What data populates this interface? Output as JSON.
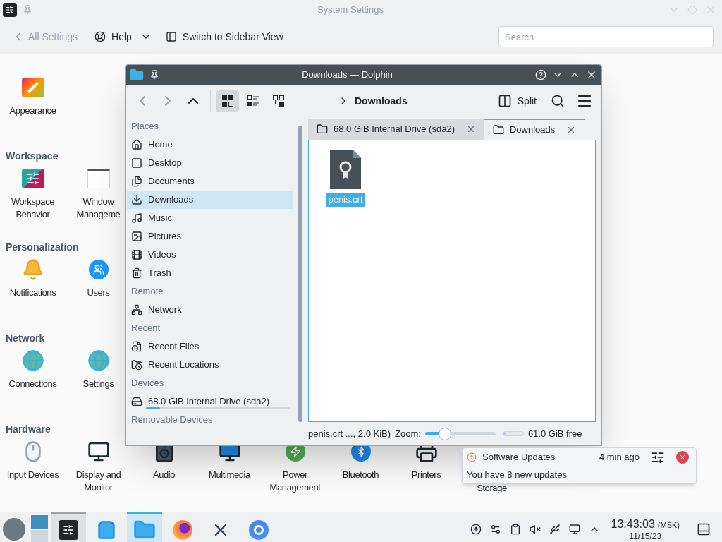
{
  "settings_window": {
    "title": "System Settings",
    "back_button": "All Settings",
    "help_button": "Help",
    "switch_view_button": "Switch to Sidebar View",
    "search": {
      "placeholder": "Search"
    },
    "sections": [
      {
        "items": [
          {
            "label": "Appearance",
            "kind": "appearance"
          }
        ]
      },
      {
        "heading": "Workspace",
        "items": [
          {
            "label": "Workspace Behavior",
            "kind": "workspace"
          },
          {
            "label": "Window Manageme",
            "kind": "window"
          }
        ]
      },
      {
        "heading": "Personalization",
        "items": [
          {
            "label": "Notifications",
            "kind": "bell"
          },
          {
            "label": "Users",
            "kind": "users"
          }
        ]
      },
      {
        "heading": "Network",
        "items": [
          {
            "label": "Connections",
            "kind": "globe"
          },
          {
            "label": "Settings",
            "kind": "globe"
          }
        ]
      },
      {
        "heading": "Hardware",
        "items": [
          {
            "label": "Input Devices",
            "kind": "mouse"
          },
          {
            "label": "Display and Monitor",
            "kind": "display"
          },
          {
            "label": "Audio",
            "kind": "speaker"
          },
          {
            "label": "Multimedia",
            "kind": "media"
          },
          {
            "label": "Power Management",
            "kind": "power"
          },
          {
            "label": "Bluetooth",
            "kind": "bluetooth"
          },
          {
            "label": "Printers",
            "kind": "printer"
          },
          {
            "label": "Storage",
            "kind": "hidden"
          }
        ]
      }
    ]
  },
  "dolphin": {
    "title": "Downloads — Dolphin",
    "view_modes": [
      {
        "kind": "icons",
        "selected": true
      },
      {
        "kind": "details",
        "selected": false
      },
      {
        "kind": "tree",
        "selected": false
      }
    ],
    "breadcrumb": "Downloads",
    "split_button": "Split",
    "places": [
      {
        "heading": "Places",
        "items": [
          {
            "label": "Home",
            "kind": "home",
            "selected": false
          },
          {
            "label": "Desktop",
            "kind": "desktop",
            "selected": false
          },
          {
            "label": "Documents",
            "kind": "documents",
            "selected": false
          },
          {
            "label": "Downloads",
            "kind": "downloads",
            "selected": true
          },
          {
            "label": "Music",
            "kind": "music",
            "selected": false
          },
          {
            "label": "Pictures",
            "kind": "pictures",
            "selected": false
          },
          {
            "label": "Videos",
            "kind": "videos",
            "selected": false
          },
          {
            "label": "Trash",
            "kind": "trash",
            "selected": false
          }
        ]
      },
      {
        "heading": "Remote",
        "items": [
          {
            "label": "Network",
            "kind": "network",
            "selected": false
          }
        ]
      },
      {
        "heading": "Recent",
        "items": [
          {
            "label": "Recent Files",
            "kind": "recent-file",
            "selected": false
          },
          {
            "label": "Recent Locations",
            "kind": "recent-folder",
            "selected": false
          }
        ]
      },
      {
        "heading": "Devices",
        "items": [
          {
            "label": "68.0 GiB Internal Drive (sda2)",
            "kind": "drive",
            "selected": false,
            "level": 0.1
          }
        ]
      },
      {
        "heading": "Removable Devices"
      }
    ],
    "tabs": [
      {
        "label": "68.0 GiB Internal Drive (sda2)",
        "selected": false
      },
      {
        "label": "Downloads",
        "selected": true
      }
    ],
    "files": [
      {
        "name": "penis.crt",
        "selected": true
      }
    ],
    "status_bar": {
      "selection": "penis.crt ..., 2.0 KiB)",
      "zoom_label": "Zoom:",
      "zoom": {
        "level": 0.28
      },
      "free_space": {
        "level": 0.1
      },
      "free_text": "61.0 GiB free"
    }
  },
  "notification": {
    "app": "Software Updates",
    "time": "4 min ago",
    "body": "You have 8 new updates"
  },
  "taskbar": {
    "apps": [
      {
        "kind": "settings",
        "selected": true
      },
      {
        "kind": "store",
        "selected": false
      },
      {
        "kind": "files",
        "selected": true
      },
      {
        "kind": "firefox",
        "selected": false
      },
      {
        "kind": "x",
        "selected": false
      },
      {
        "kind": "chromium",
        "selected": false
      }
    ],
    "clock": {
      "time": "13:43:03",
      "zone": "(MSK)",
      "date": "11/15/23"
    }
  }
}
